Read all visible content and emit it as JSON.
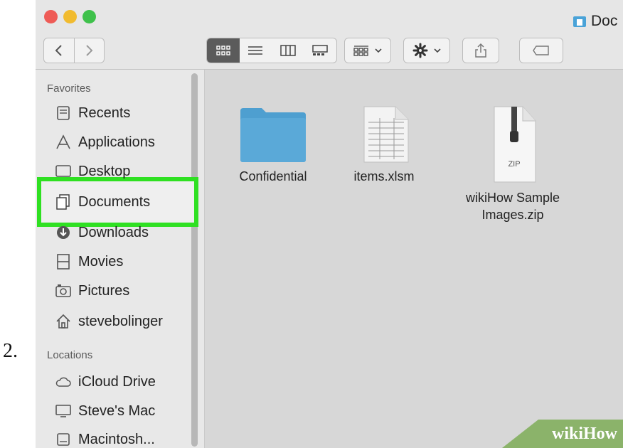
{
  "step_number": "2.",
  "window": {
    "title": "Doc",
    "view_modes": [
      "icon-view-icon",
      "list-view-icon",
      "column-view-icon",
      "gallery-view-icon"
    ],
    "selected_view": "icon-view-icon"
  },
  "sidebar": {
    "favorites_label": "Favorites",
    "favorites": [
      {
        "label": "Recents",
        "icon": "recents-icon"
      },
      {
        "label": "Applications",
        "icon": "applications-icon"
      },
      {
        "label": "Desktop",
        "icon": "desktop-icon"
      },
      {
        "label": "Documents",
        "icon": "documents-icon",
        "selected": true
      },
      {
        "label": "Downloads",
        "icon": "downloads-icon"
      },
      {
        "label": "Movies",
        "icon": "movies-icon"
      },
      {
        "label": "Pictures",
        "icon": "pictures-icon"
      },
      {
        "label": "stevebolinger",
        "icon": "home-icon"
      }
    ],
    "locations_label": "Locations",
    "locations": [
      {
        "label": "iCloud Drive",
        "icon": "icloud-icon"
      },
      {
        "label": "Steve's Mac",
        "icon": "computer-icon"
      },
      {
        "label": "Macintosh...",
        "icon": "disk-icon"
      }
    ]
  },
  "files": [
    {
      "name": "Confidential",
      "icon": "folder-icon"
    },
    {
      "name": "items.xlsm",
      "icon": "spreadsheet-file-icon"
    },
    {
      "name": "wikiHow Sample Images.zip",
      "icon": "zip-file-icon",
      "badge": "ZIP"
    }
  ],
  "watermark": {
    "text": "wikiHow"
  },
  "colors": {
    "highlight": "#2fe022",
    "folder": "#5aa9d8"
  }
}
